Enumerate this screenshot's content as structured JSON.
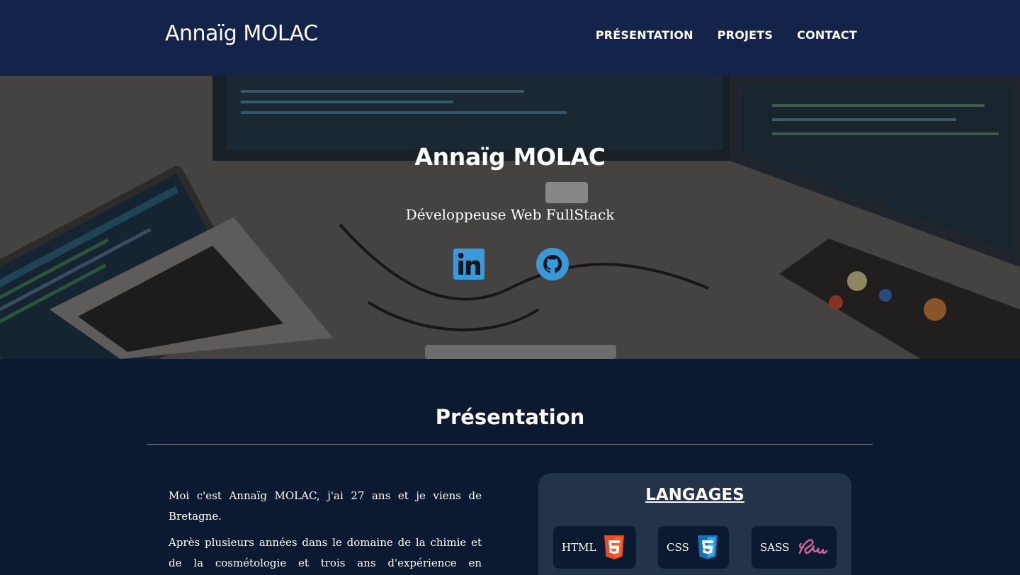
{
  "header": {
    "brand": "Annaïg MOLAC",
    "nav": [
      "PRÉSENTATION",
      "PROJETS",
      "CONTACT"
    ]
  },
  "hero": {
    "title": "Annaïg MOLAC",
    "subtitle": "Développeuse Web FullStack",
    "social": [
      {
        "name": "linkedin-icon",
        "color": "#3a9ad9"
      },
      {
        "name": "github-icon",
        "color": "#3a9ad9"
      }
    ]
  },
  "presentation": {
    "title": "Présentation",
    "bio_p1": "Moi c'est Annaïg MOLAC, j'ai 27 ans et je viens de Bretagne.",
    "bio_p2": "Après plusieurs années dans le domaine de la chimie et de la cosmétologie et trois ans d'expérience en réglementation cosmétique, j'ai décidé de me réorienter"
  },
  "languages": {
    "title": "LANGAGES",
    "items": [
      {
        "label": "HTML",
        "icon": "html5-icon",
        "color": "#e44d26"
      },
      {
        "label": "CSS",
        "icon": "css3-icon",
        "color": "#1572b6"
      },
      {
        "label": "SASS",
        "icon": "sass-icon",
        "color": "#cd6799"
      }
    ]
  }
}
